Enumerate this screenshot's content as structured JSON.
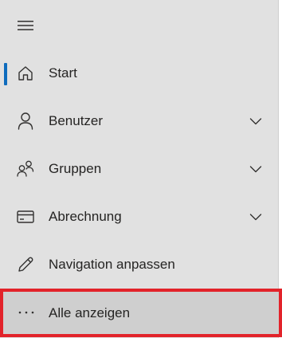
{
  "nav": {
    "menu_icon": "hamburger-icon",
    "active_color": "#0f6cbd",
    "items": [
      {
        "label": "Start",
        "icon": "home-icon",
        "active": true,
        "expandable": false
      },
      {
        "label": "Benutzer",
        "icon": "person-icon",
        "active": false,
        "expandable": true
      },
      {
        "label": "Gruppen",
        "icon": "people-icon",
        "active": false,
        "expandable": true
      },
      {
        "label": "Abrechnung",
        "icon": "credit-card-icon",
        "active": false,
        "expandable": true
      },
      {
        "label": "Navigation anpassen",
        "icon": "pencil-icon",
        "active": false,
        "expandable": false
      }
    ],
    "show_all": {
      "label": "Alle anzeigen",
      "icon": "more-horizontal-icon",
      "highlight_color": "#e2232a"
    }
  }
}
